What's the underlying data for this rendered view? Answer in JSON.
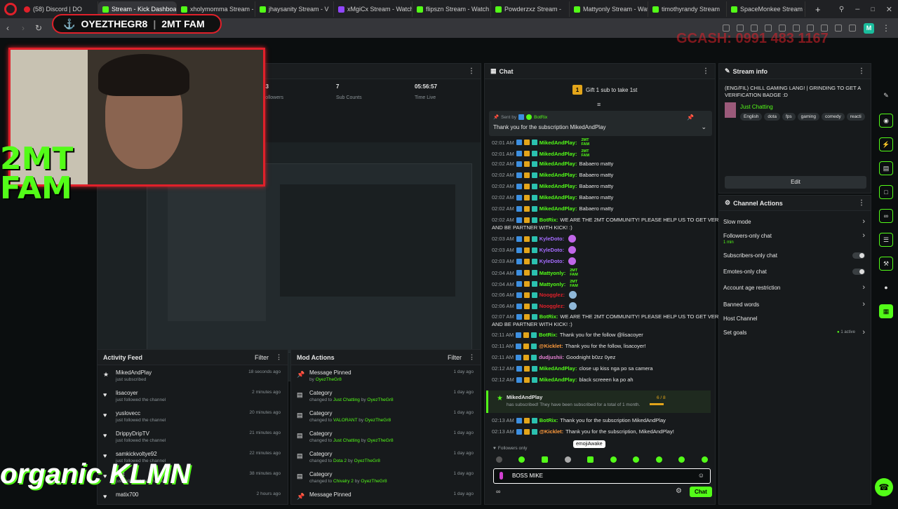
{
  "browser": {
    "tabs": [
      {
        "label": "(58) Discord | DO",
        "fav": "red"
      },
      {
        "label": "Stream - Kick Dashboard",
        "fav": "green",
        "active": true
      },
      {
        "label": "xholymomma Stream -",
        "fav": "green"
      },
      {
        "label": "jhaysanity Stream - V",
        "fav": "green"
      },
      {
        "label": "xMgiCx Stream - Watch L",
        "fav": "purple"
      },
      {
        "label": "flipszn Stream - Watch L",
        "fav": "green"
      },
      {
        "label": "Powderzxz Stream -",
        "fav": "green"
      },
      {
        "label": "Mattyonly Stream - Watc",
        "fav": "green"
      },
      {
        "label": "timothyrandy Stream",
        "fav": "green"
      },
      {
        "label": "SpaceMonkee Stream - V",
        "fav": "green"
      }
    ],
    "new_tab": "+",
    "profile_initial": "M"
  },
  "overlay": {
    "banner_left": "OYEZTHEGR8",
    "banner_right": "2MT FAM",
    "big_text": "2MT\nFAM",
    "brand": "organic KLMN",
    "gcash": "GCASH: 0991 483 1167"
  },
  "stats": [
    {
      "value": "33",
      "label": "Followers"
    },
    {
      "value": "7",
      "label": "Sub Counts"
    },
    {
      "value": "05:56:57",
      "label": "Time Live"
    }
  ],
  "chat": {
    "title": "Chat",
    "gift_label": "Gift 1 sub to take 1st",
    "gift_rank": "1",
    "pinned_by_label": "Sent by",
    "pinned_by_user": "BotRix",
    "pinned_message": "Thank you for the subscription MikedAndPlay",
    "messages": [
      {
        "time": "02:01 AM",
        "user": "MikedAndPlay:",
        "text": "",
        "cls": "u-green",
        "emote": "2MT FAM"
      },
      {
        "time": "02:01 AM",
        "user": "MikedAndPlay:",
        "text": "",
        "cls": "u-green",
        "emote": "2MT FAM"
      },
      {
        "time": "02:02 AM",
        "user": "MikedAndPlay:",
        "text": "Babaero matty",
        "cls": "u-green"
      },
      {
        "time": "02:02 AM",
        "user": "MikedAndPlay:",
        "text": "Babaero matty",
        "cls": "u-green"
      },
      {
        "time": "02:02 AM",
        "user": "MikedAndPlay:",
        "text": "Babaero matty",
        "cls": "u-green"
      },
      {
        "time": "02:02 AM",
        "user": "MikedAndPlay:",
        "text": "Babaero matty",
        "cls": "u-green"
      },
      {
        "time": "02:02 AM",
        "user": "MikedAndPlay:",
        "text": "Babaero matty",
        "cls": "u-green"
      },
      {
        "time": "02:02 AM",
        "user": "BotRix:",
        "text": "WE ARE THE 2MT COMMUNITY! PLEASE HELP US TO GET VERIFIED",
        "cls": "u-green",
        "text2": "AND BE PARTNER WITH KICK! :)"
      },
      {
        "time": "02:03 AM",
        "user": "KyleDoto:",
        "text": "",
        "cls": "u-purple"
      },
      {
        "time": "02:03 AM",
        "user": "KyleDoto:",
        "text": "",
        "cls": "u-purple"
      },
      {
        "time": "02:03 AM",
        "user": "KyleDoto:",
        "text": "",
        "cls": "u-purple"
      },
      {
        "time": "02:04 AM",
        "user": "Mattyonly:",
        "text": "",
        "cls": "u-green",
        "emote": "2MT FAM"
      },
      {
        "time": "02:04 AM",
        "user": "Mattyonly:",
        "text": "",
        "cls": "u-green",
        "emote": "2MT FAM"
      },
      {
        "time": "02:06 AM",
        "user": "Noogglez:",
        "text": "",
        "cls": "u-red"
      },
      {
        "time": "02:06 AM",
        "user": "Noogglez:",
        "text": "",
        "cls": "u-red"
      },
      {
        "time": "02:07 AM",
        "user": "BotRix:",
        "text": "WE ARE THE 2MT COMMUNITY! PLEASE HELP US TO GET VERIFIED",
        "cls": "u-green",
        "text2": "AND BE PARTNER WITH KICK! :)"
      },
      {
        "time": "02:11 AM",
        "user": "BotRix:",
        "text": "Thank you for the follow @lisacoyer",
        "cls": "u-green"
      },
      {
        "time": "02:11 AM",
        "user": "@Kicklet:",
        "text": "Thank you for the follow, lisacoyer!",
        "cls": "u-orange"
      },
      {
        "time": "02:11 AM",
        "user": "dudjushii:",
        "text": "Goodnight b0zz 0yez",
        "cls": "u-pink"
      },
      {
        "time": "02:12 AM",
        "user": "MikedAndPlay:",
        "text": "close up kiss nga po sa camera",
        "cls": "u-green"
      },
      {
        "time": "02:12 AM",
        "user": "MikedAndPlay:",
        "text": "black screeen ka po ah",
        "cls": "u-green"
      }
    ],
    "sub_user": "MikedAndPlay",
    "sub_text": "has subscribed! They have been subscribed for a total of 1 month.",
    "sub_progress": "6 / 8",
    "after": [
      {
        "time": "02:13 AM",
        "user": "BotRix:",
        "text": "Thank you for the subscription MikedAndPlay",
        "cls": "u-green"
      },
      {
        "time": "02:13 AM",
        "user": "@Kicklet:",
        "text": "Thank you for the subscription, MikedAndPlay!",
        "cls": "u-orange"
      }
    ],
    "followers_only": "Followers only",
    "tooltip": "emojiAwake",
    "input_value": "BOSS MIKE",
    "send_label": "Chat"
  },
  "activity": {
    "title": "Activity Feed",
    "filter": "Filter",
    "items": [
      {
        "icon": "★",
        "name": "MikedAndPlay",
        "sub": "just subscribed",
        "time": "18 seconds ago"
      },
      {
        "icon": "♥",
        "name": "lisacoyer",
        "sub": "just followed the channel",
        "time": "2 minutes ago"
      },
      {
        "icon": "♥",
        "name": "yuslovecc",
        "sub": "just followed the channel",
        "time": "20 minutes ago"
      },
      {
        "icon": "♥",
        "name": "DrippyDripTV",
        "sub": "just followed the channel",
        "time": "21 minutes ago"
      },
      {
        "icon": "♥",
        "name": "samkickvoltye92",
        "sub": "just followed the channel",
        "time": "22 minutes ago"
      },
      {
        "icon": "♥",
        "name": "lest",
        "sub": "just followed the channel",
        "time": "38 minutes ago"
      },
      {
        "icon": "♥",
        "name": "matix700",
        "sub": "",
        "time": "2 hours ago"
      }
    ]
  },
  "mod": {
    "title": "Mod Actions",
    "filter": "Filter",
    "items": [
      {
        "icon": "pin",
        "title": "Message Pinned",
        "pre": "by",
        "a": "OyezTheGr8",
        "mid": "",
        "b": "",
        "time": "1 day ago"
      },
      {
        "icon": "cat",
        "title": "Category",
        "pre": "changed to",
        "a": "Just Chatting",
        "mid": "by",
        "b": "OyezTheGr8",
        "time": "1 day ago"
      },
      {
        "icon": "cat",
        "title": "Category",
        "pre": "changed to",
        "a": "VALORANT",
        "mid": "by",
        "b": "OyezTheGr8",
        "time": "1 day ago"
      },
      {
        "icon": "cat",
        "title": "Category",
        "pre": "changed to",
        "a": "Just Chatting",
        "mid": "by",
        "b": "OyezTheGr8",
        "time": "1 day ago"
      },
      {
        "icon": "cat",
        "title": "Category",
        "pre": "changed to",
        "a": "Dota 2",
        "mid": "by",
        "b": "OyezTheGr8",
        "time": "1 day ago"
      },
      {
        "icon": "cat",
        "title": "Category",
        "pre": "changed to",
        "a": "Chivalry 2",
        "mid": "by",
        "b": "OyezTheGr8",
        "time": "1 day ago"
      },
      {
        "icon": "pin",
        "title": "Message Pinned",
        "pre": "",
        "a": "",
        "mid": "",
        "b": "",
        "time": "1 day ago"
      }
    ]
  },
  "stream_info": {
    "title": "Stream info",
    "stream_title": "(ENG/FIL) CHILL GAMING LANG! | GRINDING TO GET A VERIFICATION BADGE :D",
    "category": "Just Chatting",
    "tags": [
      "English",
      "dota",
      "fps",
      "gaming",
      "comedy",
      "reacti"
    ],
    "edit": "Edit"
  },
  "channel_actions": {
    "title": "Channel Actions",
    "rows": [
      {
        "label": "Slow mode",
        "type": "chev",
        "sub": ""
      },
      {
        "label": "Followers-only chat",
        "type": "chev",
        "sub": "1 min"
      },
      {
        "label": "Subscribers-only chat",
        "type": "toggle",
        "sub": ""
      },
      {
        "label": "Emotes-only chat",
        "type": "toggle",
        "sub": ""
      },
      {
        "label": "Account age restriction",
        "type": "chev",
        "sub": ""
      },
      {
        "label": "Banned words",
        "type": "chev",
        "sub": ""
      },
      {
        "label": "Host Channel",
        "type": "none",
        "sub": ""
      },
      {
        "label": "Set goals",
        "type": "chev",
        "sub": "",
        "badge": "1 active"
      }
    ]
  }
}
